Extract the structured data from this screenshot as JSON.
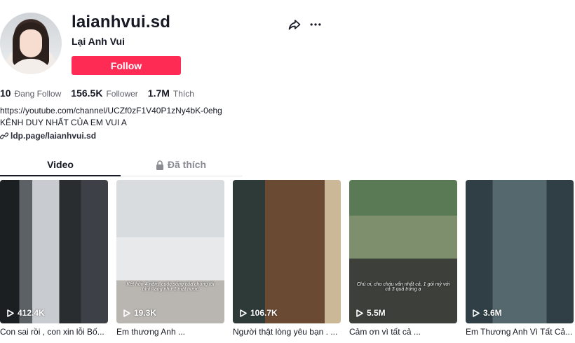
{
  "profile": {
    "username": "laianhvui.sd",
    "nickname": "Lại Anh Vui",
    "follow_label": "Follow",
    "stats": [
      {
        "value": "10",
        "label": "Đang Follow"
      },
      {
        "value": "156.5K",
        "label": "Follower"
      },
      {
        "value": "1.7M",
        "label": "Thích"
      }
    ],
    "bio_line1": "https://youtube.com/channel/UCZf0zF1V40P1zNy4bK-0ehg",
    "bio_line2": "KÊNH DUY NHẤT CỦA EM VUI A",
    "link": "ldp.page/laianhvui.sd",
    "accent_color": "#fe2c55"
  },
  "icons": {
    "share": "share-icon",
    "more": "more-icon",
    "link": "link-icon",
    "lock": "lock-icon",
    "play": "play-icon"
  },
  "tabs": [
    {
      "label": "Video",
      "active": true
    },
    {
      "label": "Đã thích",
      "active": false
    }
  ],
  "videos": [
    {
      "views": "412.4K",
      "caption": "Con sai rồi , con xin lỗi Bố...",
      "overlay": ""
    },
    {
      "views": "19.3K",
      "caption": "Em thương Anh ...",
      "overlay": "Kết hôn 4 năm, cuộc sống của chúng tôi bình lặng như 1 mặt nước"
    },
    {
      "views": "106.7K",
      "caption": "Người thật lòng yêu bạn . ...",
      "overlay": ""
    },
    {
      "views": "5.5M",
      "caption": "Cảm ơn vì tất cả ...",
      "overlay": "Chú ơi, cho cháu vấn nhất cả, 1 gói mỳ với cả 3 quả trứng ạ"
    },
    {
      "views": "3.6M",
      "caption": "Em Thương Anh Vì Tất Cả...",
      "overlay": ""
    }
  ]
}
